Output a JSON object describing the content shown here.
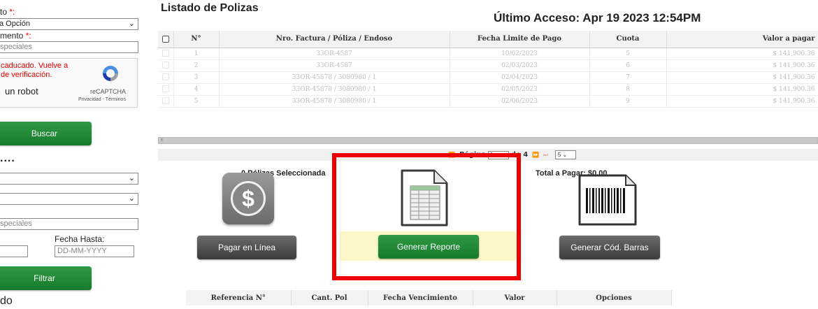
{
  "sidebar": {
    "label1": "to",
    "label1_req": "*:",
    "select1_value": "a Opción",
    "label2": "mento",
    "label2_req": "*:",
    "input1_value": "speciales",
    "captcha": {
      "error_line1": "caducado. Vuelve a",
      "error_line2": "de verificación.",
      "robot_text": "un robot",
      "brand": "reCAPTCHA",
      "links": "Privacidad - Términos"
    },
    "search_button": "Buscar",
    "section_dots": "....",
    "input2_value": "speciales",
    "date_to_label": "Fecha Hasta:",
    "date_to_placeholder": "DD-MM-YYYY",
    "filter_button": "Filtrar",
    "bottom_text": "do"
  },
  "main": {
    "title": "Listado de Polizas",
    "last_access": "Último Acceso: Apr 19 2023 12:54PM",
    "grid": {
      "headers": {
        "num": "N°",
        "factura": "Nro. Factura / Póliza / Endoso",
        "fecha": "Fecha Limite de Pago",
        "cuota": "Cuota",
        "valor": "Valor a pagar"
      },
      "rows": [
        {
          "num": "1",
          "factura": "33OR-4587",
          "fecha": "10/02/2023",
          "cuota": "5",
          "valor": "$ 141,900.36"
        },
        {
          "num": "2",
          "factura": "33OR-4587",
          "fecha": "02/03/2023",
          "cuota": "6",
          "valor": "$ 141,900.36"
        },
        {
          "num": "3",
          "factura": "33OR-45878 / 3080980 / 1",
          "fecha": "02/04/2023",
          "cuota": "7",
          "valor": "$ 141,900.36"
        },
        {
          "num": "4",
          "factura": "33OR-45878 / 3080980 / 1",
          "fecha": "02/05/2023",
          "cuota": "8",
          "valor": "$ 141,900.36"
        },
        {
          "num": "5",
          "factura": "33OR-45878 / 3080980 / 1",
          "fecha": "02/06/2023",
          "cuota": "9",
          "valor": "$ 141,900.36"
        }
      ]
    },
    "pager": {
      "page_label": "Página",
      "page_value": "1",
      "of_label": "de 4",
      "page_size": "5"
    },
    "selected_count": "0  Pólizas Seleccionada",
    "total": "Total a Pagar: $0.00",
    "actions": {
      "pay_online": "Pagar en Línea",
      "generate_report": "Generar Reporte",
      "generate_barcode": "Generar Cód. Barras"
    },
    "summary_headers": {
      "ref": "Referencia N°",
      "cant": "Cant. Pol",
      "venc": "Fecha Vencimiento",
      "valor": "Valor",
      "opciones": "Opciones"
    }
  },
  "colors": {
    "green_button": "#1f8a36",
    "dark_button": "#4a4a4a",
    "highlight": "#fbf7c7",
    "annotation_red": "#ee0000",
    "required_red": "#ee0000"
  }
}
